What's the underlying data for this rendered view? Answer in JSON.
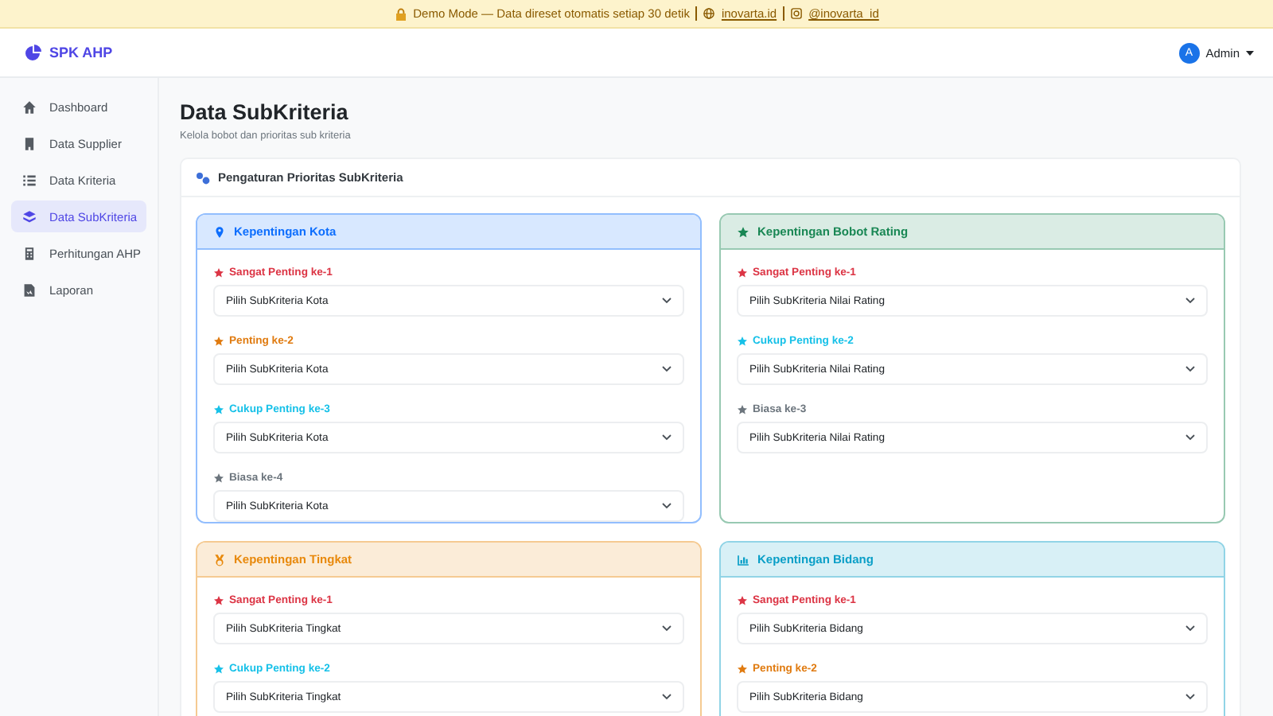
{
  "banner": {
    "message": "Demo Mode — Data direset otomatis setiap 30 detik",
    "links": [
      "inovarta.id",
      "@inovarta_id"
    ]
  },
  "navbar": {
    "brand": "SPK AHP",
    "user_initial": "A",
    "user_name": "Admin"
  },
  "sidebar": {
    "items": [
      {
        "label": "Dashboard",
        "selected": false
      },
      {
        "label": "Data Supplier",
        "selected": false
      },
      {
        "label": "Data Kriteria",
        "selected": false
      },
      {
        "label": "Data SubKriteria",
        "selected": true
      },
      {
        "label": "Perhitungan AHP",
        "selected": false
      },
      {
        "label": "Laporan",
        "selected": false
      }
    ]
  },
  "page": {
    "title": "Data SubKriteria",
    "subtitle": "Kelola bobot dan prioritas sub kriteria"
  },
  "card": {
    "title": "Pengaturan Prioritas SubKriteria",
    "groups": [
      {
        "title": "Kepentingan Kota",
        "color": "#0d6efd",
        "fields": [
          {
            "label": "Sangat Penting ke-1",
            "kind": "very",
            "placeholder": "Pilih SubKriteria Kota"
          },
          {
            "label": "Penting ke-2",
            "kind": "important",
            "placeholder": "Pilih SubKriteria Kota"
          },
          {
            "label": "Cukup Penting ke-3",
            "kind": "fair",
            "placeholder": "Pilih SubKriteria Kota"
          },
          {
            "label": "Biasa ke-4",
            "kind": "normal",
            "placeholder": "Pilih SubKriteria Kota"
          }
        ]
      },
      {
        "title": "Kepentingan Bobot Rating",
        "color": "#198754",
        "fields": [
          {
            "label": "Sangat Penting ke-1",
            "kind": "very",
            "placeholder": "Pilih SubKriteria Nilai Rating"
          },
          {
            "label": "Cukup Penting ke-2",
            "kind": "fair",
            "placeholder": "Pilih SubKriteria Nilai Rating"
          },
          {
            "label": "Biasa ke-3",
            "kind": "normal",
            "placeholder": "Pilih SubKriteria Nilai Rating"
          }
        ]
      },
      {
        "title": "Kepentingan Tingkat",
        "color": "#e8890c",
        "fields": [
          {
            "label": "Sangat Penting ke-1",
            "kind": "very",
            "placeholder": "Pilih SubKriteria Tingkat"
          },
          {
            "label": "Cukup Penting ke-2",
            "kind": "fair",
            "placeholder": "Pilih SubKriteria Tingkat"
          }
        ]
      },
      {
        "title": "Kepentingan Bidang",
        "color": "#0a9fc7",
        "fields": [
          {
            "label": "Sangat Penting ke-1",
            "kind": "very",
            "placeholder": "Pilih SubKriteria Bidang"
          },
          {
            "label": "Penting ke-2",
            "kind": "important",
            "placeholder": "Pilih SubKriteria Bidang"
          }
        ]
      }
    ]
  }
}
